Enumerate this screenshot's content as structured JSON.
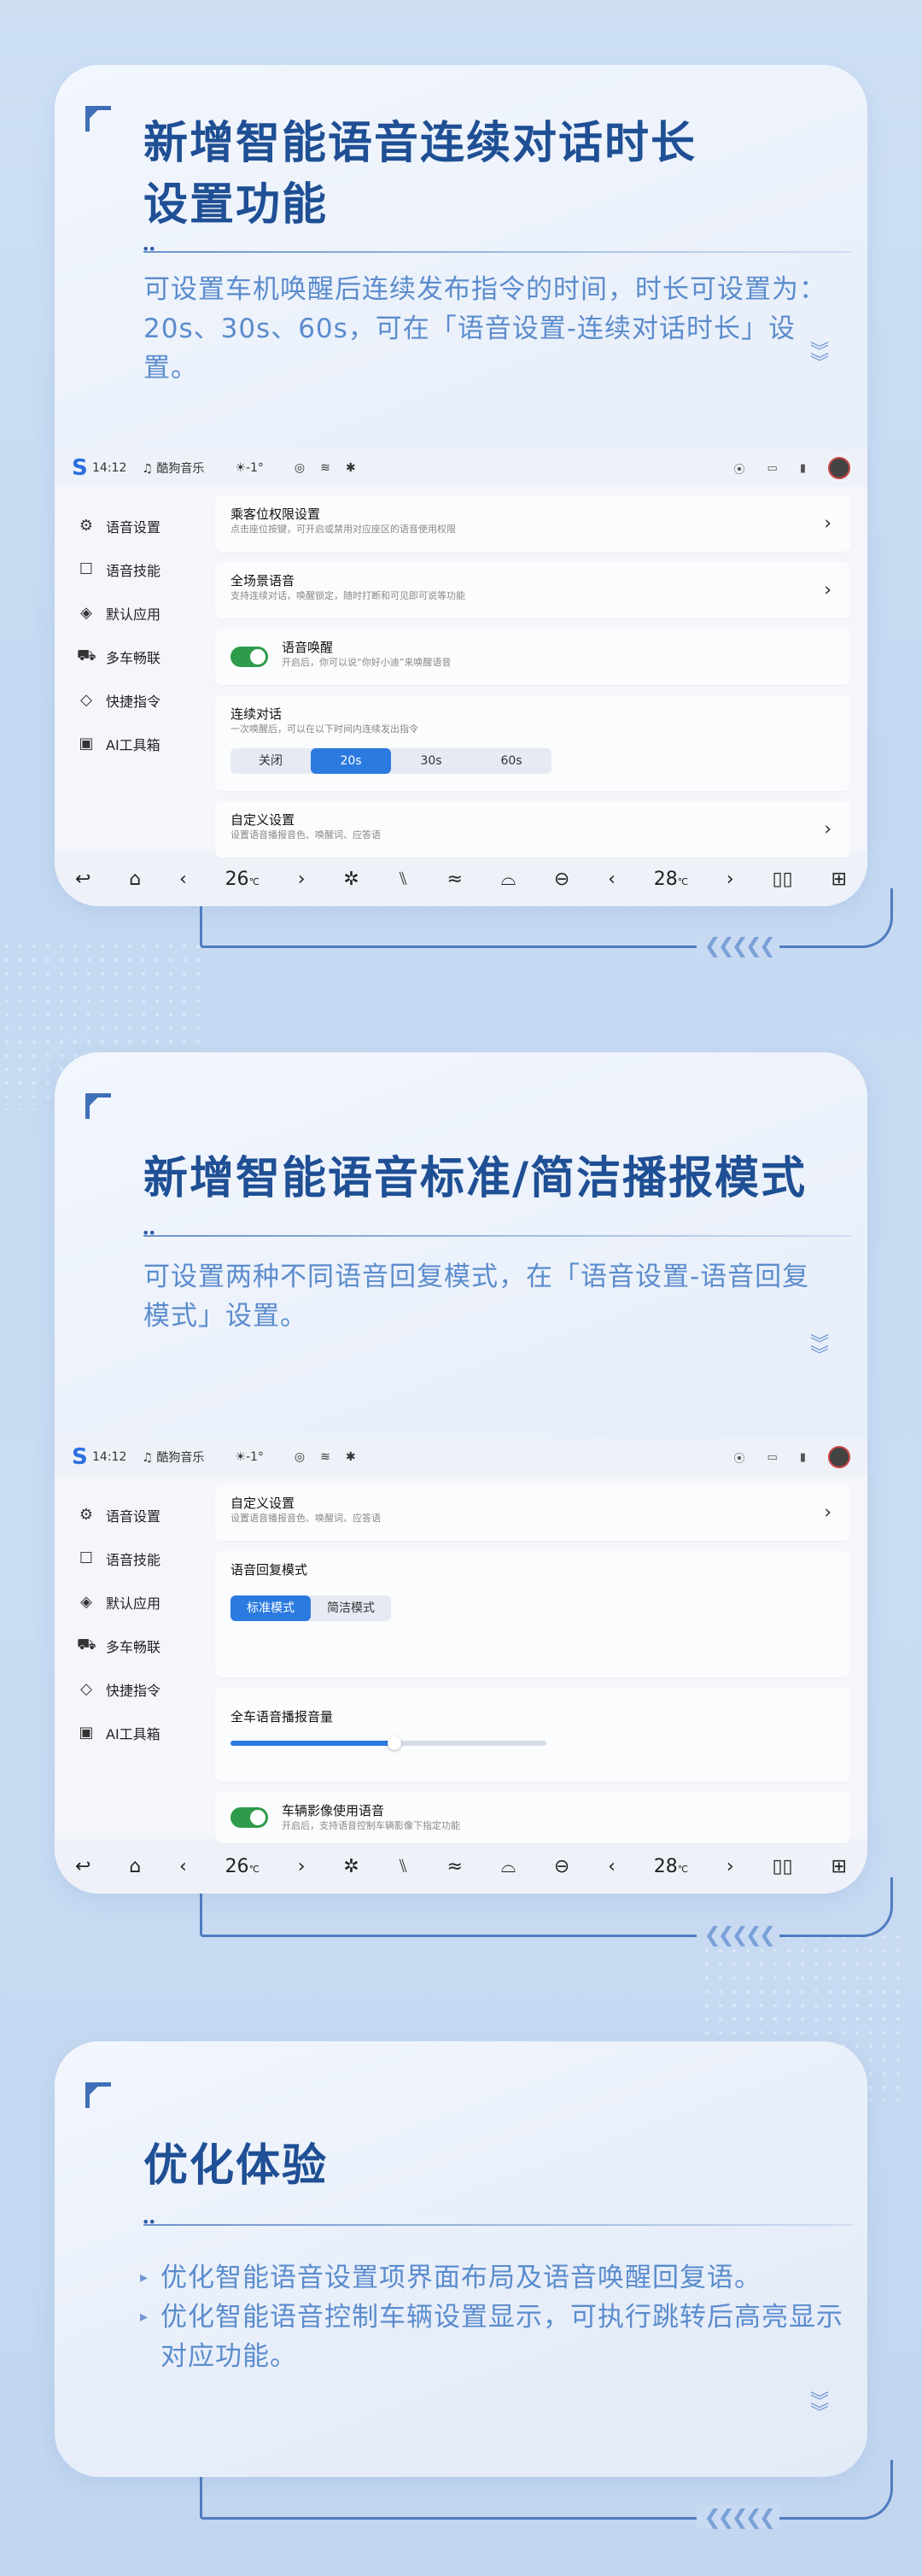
{
  "section1": {
    "title_line1": "新增智能语音连续对话时长",
    "title_line2": "设置功能",
    "desc": "可设置车机唤醒后连续发布指令的时间，时长可设置为：20s、30s、60s，可在「语音设置-连续对话时长」设置。"
  },
  "section2": {
    "title": "新增智能语音标准/简洁播报模式",
    "desc": "可设置两种不同语音回复模式，在「语音设置-语音回复模式」设置。"
  },
  "section3": {
    "title": "优化体验",
    "bullets": [
      "优化智能语音设置项界面布局及语音唤醒回复语。",
      "优化智能语音控制车辆设置显示，可执行跳转后高亮显示对应功能。"
    ]
  },
  "status": {
    "time": "14:12",
    "music": "酷狗音乐",
    "weather": "-1°"
  },
  "sidebar": [
    {
      "label": "语音设置",
      "icon": "gear-icon"
    },
    {
      "label": "语音技能",
      "icon": "book-icon"
    },
    {
      "label": "默认应用",
      "icon": "layers-icon"
    },
    {
      "label": "多车畅联",
      "icon": "car-icon"
    },
    {
      "label": "快捷指令",
      "icon": "stack-icon"
    },
    {
      "label": "AI工具箱",
      "icon": "toolbox-icon"
    }
  ],
  "screen1": {
    "rows": [
      {
        "title": "乘客位权限设置",
        "sub": "点击座位按键，可开启或禁用对应座区的语音使用权限"
      },
      {
        "title": "全场景语音",
        "sub": "支持连续对话，唤醒锁定，随时打断和可见即可说等功能"
      },
      {
        "title": "语音唤醒",
        "sub": "开启后，你可以说“你好小迪”来唤醒语音"
      },
      {
        "title": "连续对话",
        "sub": "一次唤醒后，可以在以下时间内连续发出指令"
      },
      {
        "title": "自定义设置",
        "sub": "设置语音播报音色、唤醒词、应答语"
      }
    ],
    "options": [
      "关闭",
      "20s",
      "30s",
      "60s"
    ]
  },
  "screen2": {
    "rows": [
      {
        "title": "自定义设置",
        "sub": "设置语音播报音色、唤醒词、应答语"
      },
      {
        "title": "语音回复模式",
        "sub": ""
      },
      {
        "title": "全车语音播报音量",
        "sub": ""
      },
      {
        "title": "车辆影像使用语音",
        "sub": "开启后，支持语音控制车辆影像下指定功能"
      }
    ],
    "modes": [
      "标准模式",
      "简洁模式"
    ],
    "volume_level": 0.52
  },
  "dock": {
    "temp_left": "26",
    "temp_right": "28",
    "unit": "℃"
  }
}
